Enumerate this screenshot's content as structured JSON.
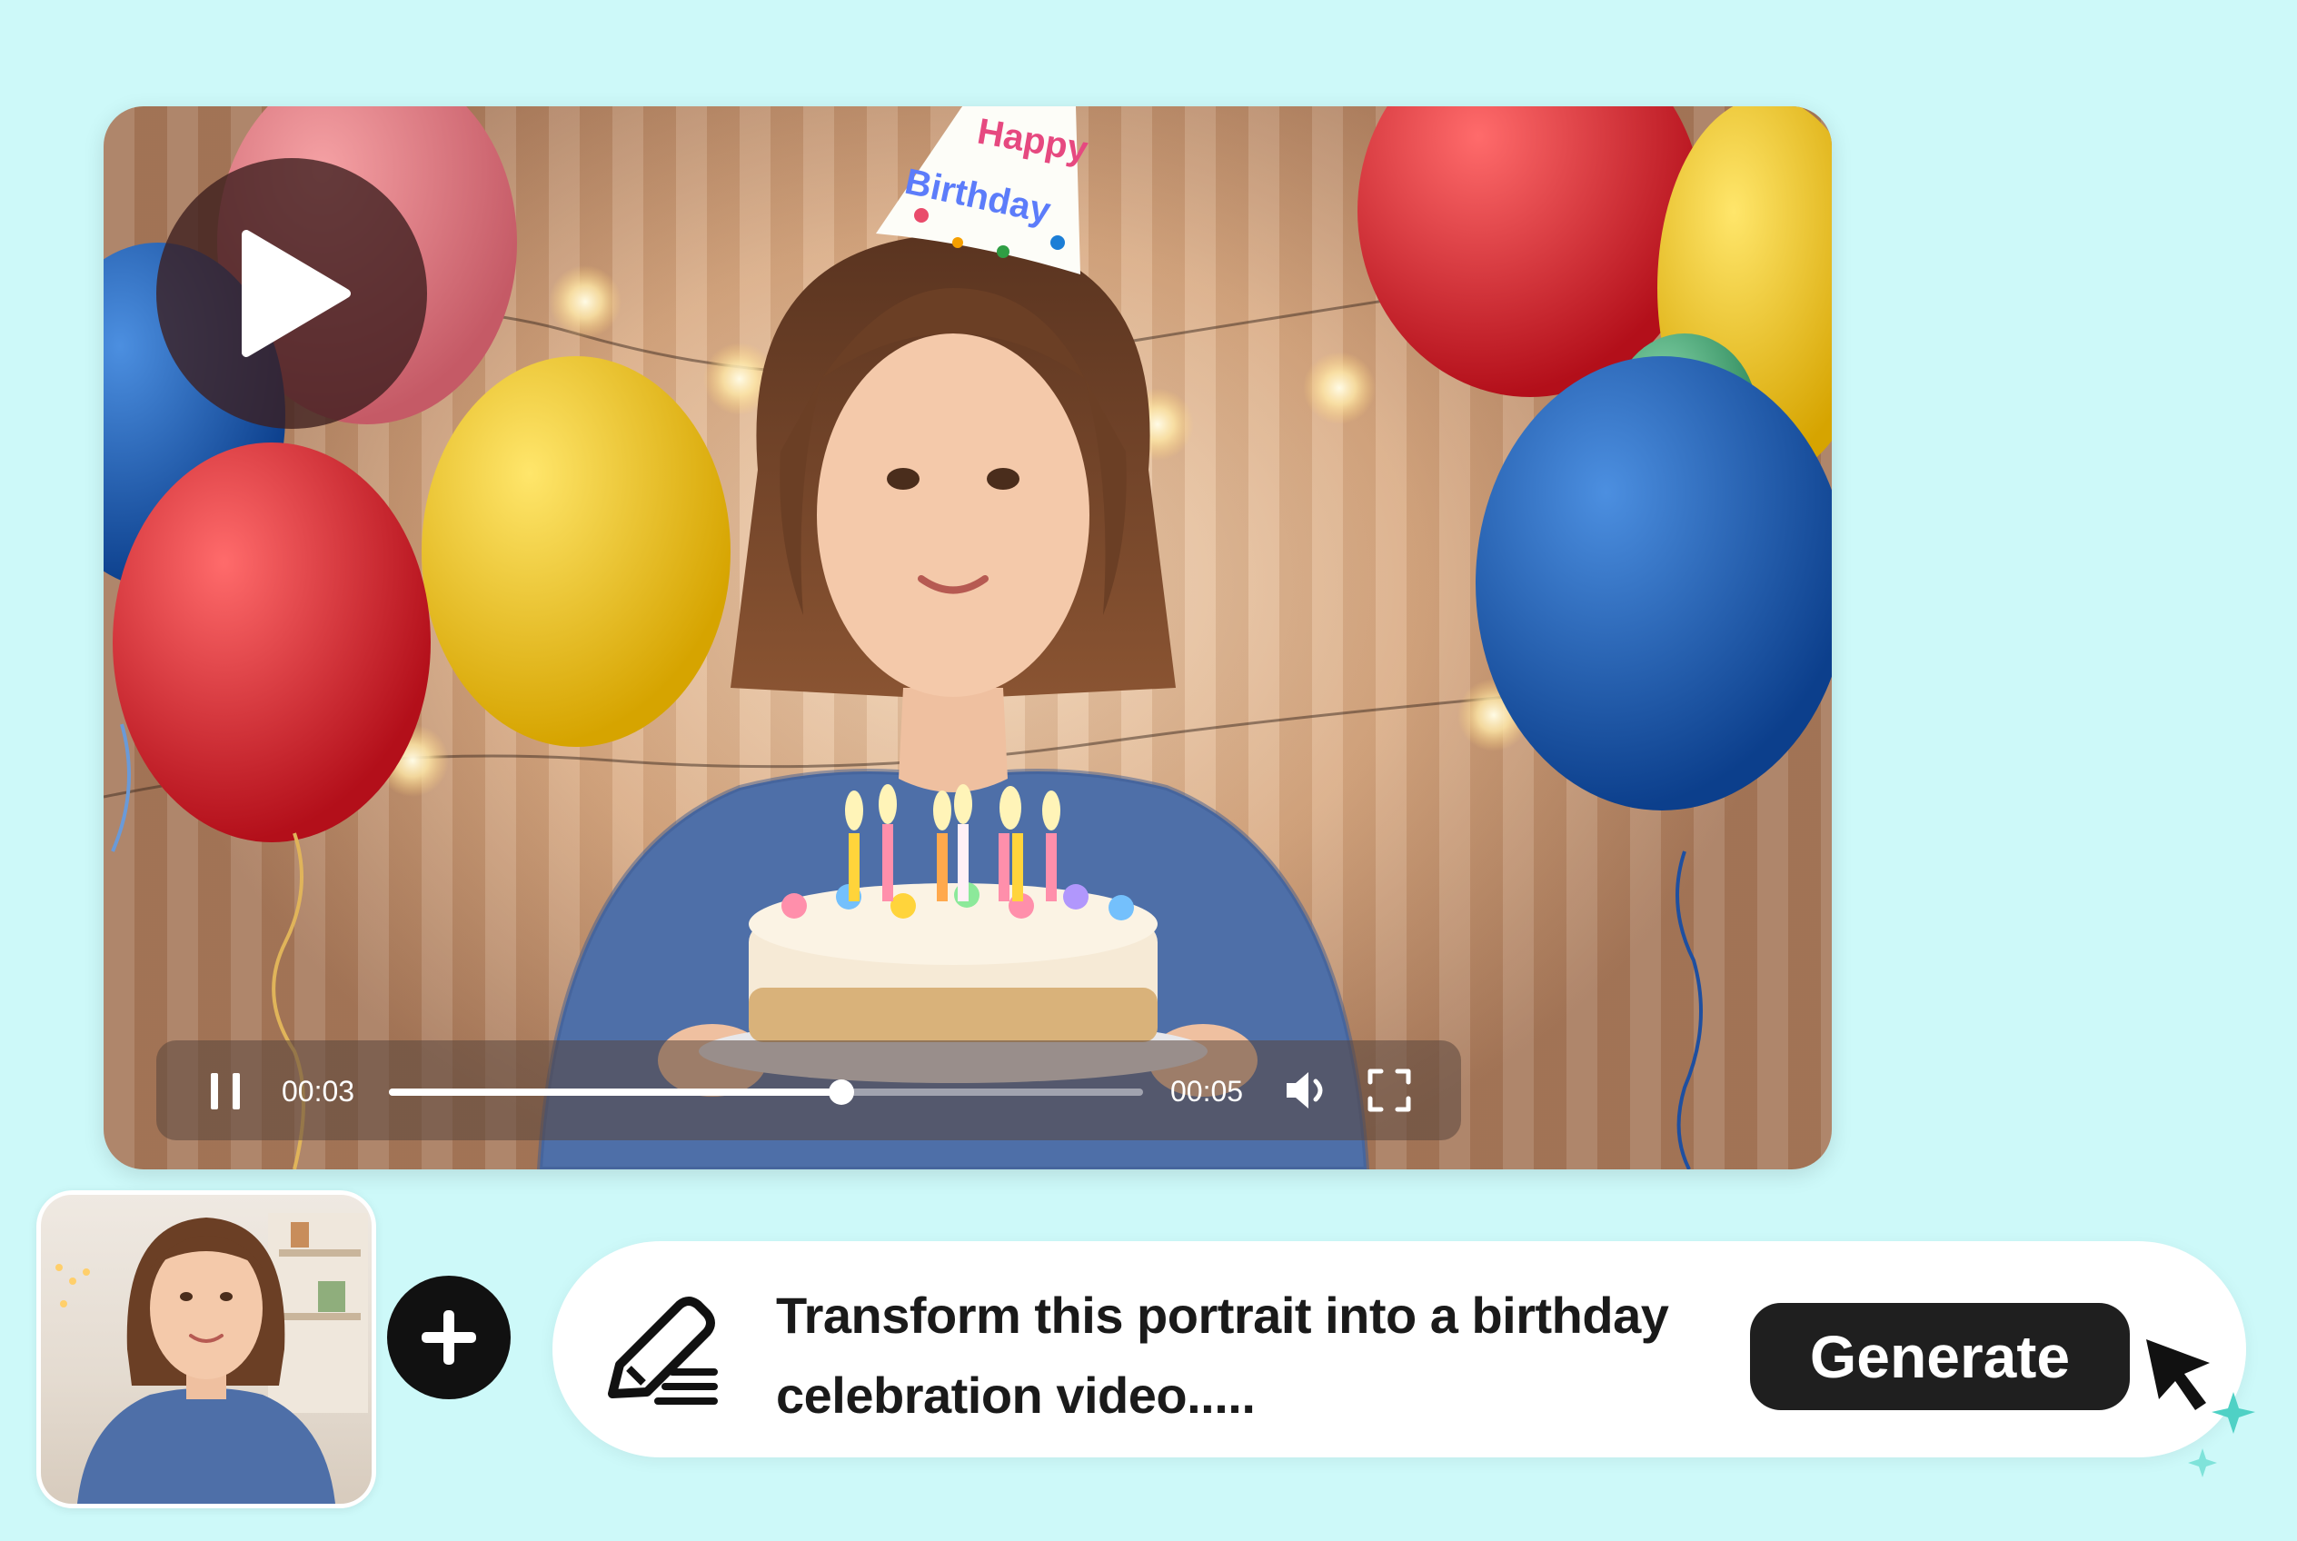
{
  "video": {
    "current_time": "00:03",
    "duration": "00:05",
    "progress": 0.6,
    "hat_text_line1": "Happy",
    "hat_text_line2": "Birthday"
  },
  "prompt": {
    "text_line1": "Transform this portrait into a birthday",
    "text_line2": "celebration video.....",
    "generate_label": "Generate"
  },
  "icons": {
    "play": "play-icon",
    "pause": "pause-icon",
    "volume": "volume-icon",
    "fullscreen": "fullscreen-icon",
    "add": "plus-icon",
    "edit": "pen-icon",
    "cursor": "mouse-pointer-icon"
  },
  "colors": {
    "background": "#cdf9f9",
    "button": "#1f1f1f",
    "sweater": "#4e6fa8"
  }
}
